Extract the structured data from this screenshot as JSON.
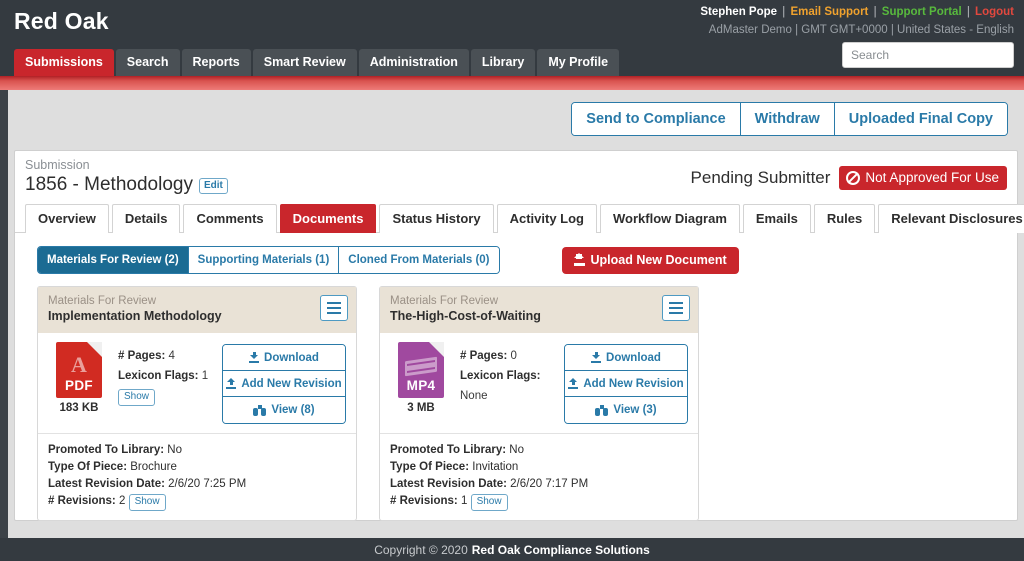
{
  "header": {
    "brand": "Red Oak",
    "user_name": "Stephen Pope",
    "email_support": "Email Support",
    "support_portal": "Support Portal",
    "logout": "Logout",
    "meta": "AdMaster Demo | GMT GMT+0000 | United States - English",
    "search_placeholder": "Search",
    "search_value": "",
    "nav": [
      {
        "label": "Submissions",
        "active": true
      },
      {
        "label": "Search",
        "active": false
      },
      {
        "label": "Reports",
        "active": false
      },
      {
        "label": "Smart Review",
        "active": false
      },
      {
        "label": "Administration",
        "active": false
      },
      {
        "label": "Library",
        "active": false
      },
      {
        "label": "My Profile",
        "active": false
      }
    ]
  },
  "actions": [
    {
      "label": "Send to Compliance"
    },
    {
      "label": "Withdraw"
    },
    {
      "label": "Uploaded Final Copy"
    }
  ],
  "submission": {
    "kicker": "Submission",
    "title": "1856 - Methodology",
    "edit_label": "Edit",
    "status_text": "Pending Submitter",
    "badge_label": "Not Approved For Use",
    "badge_icon": "ban-icon",
    "badge_color": "#c9262c"
  },
  "tabs": [
    {
      "label": "Overview",
      "active": false
    },
    {
      "label": "Details",
      "active": false
    },
    {
      "label": "Comments",
      "active": false
    },
    {
      "label": "Documents",
      "active": true
    },
    {
      "label": "Status History",
      "active": false
    },
    {
      "label": "Activity Log",
      "active": false
    },
    {
      "label": "Workflow Diagram",
      "active": false
    },
    {
      "label": "Emails",
      "active": false
    },
    {
      "label": "Rules",
      "active": false
    },
    {
      "label": "Relevant Disclosures",
      "active": false
    }
  ],
  "doc_toolbar": {
    "filters": [
      {
        "label": "Materials For Review (2)",
        "active": true
      },
      {
        "label": "Supporting Materials (1)",
        "active": false
      },
      {
        "label": "Cloned From Materials (0)",
        "active": false
      }
    ],
    "upload_label": "Upload New Document",
    "upload_icon": "upload-icon"
  },
  "documents": [
    {
      "kicker": "Materials For Review",
      "title": "Implementation Methodology",
      "file_type": "PDF",
      "file_size": "183 KB",
      "pages_label": "# Pages:",
      "pages_value": "4",
      "lexicon_label": "Lexicon Flags:",
      "lexicon_value": "1",
      "lexicon_show": "Show",
      "buttons": [
        {
          "label": "Download",
          "icon": "download-icon"
        },
        {
          "label": "Add New Revision",
          "icon": "upload-icon"
        },
        {
          "label": "View (8)",
          "icon": "binoculars-icon"
        }
      ],
      "promoted_label": "Promoted To Library:",
      "promoted_value": "No",
      "type_label": "Type Of Piece:",
      "type_value": "Brochure",
      "revision_date_label": "Latest Revision Date:",
      "revision_date_value": "2/6/20 7:25 PM",
      "revisions_label": "# Revisions:",
      "revisions_value": "2",
      "revisions_show": "Show"
    },
    {
      "kicker": "Materials For Review",
      "title": "The-High-Cost-of-Waiting",
      "file_type": "MP4",
      "file_size": "3 MB",
      "pages_label": "# Pages:",
      "pages_value": "0",
      "lexicon_label": "Lexicon Flags:",
      "lexicon_value": "None",
      "lexicon_show": "",
      "buttons": [
        {
          "label": "Download",
          "icon": "download-icon"
        },
        {
          "label": "Add New Revision",
          "icon": "upload-icon"
        },
        {
          "label": "View (3)",
          "icon": "binoculars-icon"
        }
      ],
      "promoted_label": "Promoted To Library:",
      "promoted_value": "No",
      "type_label": "Type Of Piece:",
      "type_value": "Invitation",
      "revision_date_label": "Latest Revision Date:",
      "revision_date_value": "2/6/20 7:17 PM",
      "revisions_label": "# Revisions:",
      "revisions_value": "1",
      "revisions_show": "Show"
    }
  ],
  "footer": {
    "copyright": "Copyright © 2020",
    "company": "Red Oak Compliance Solutions"
  }
}
